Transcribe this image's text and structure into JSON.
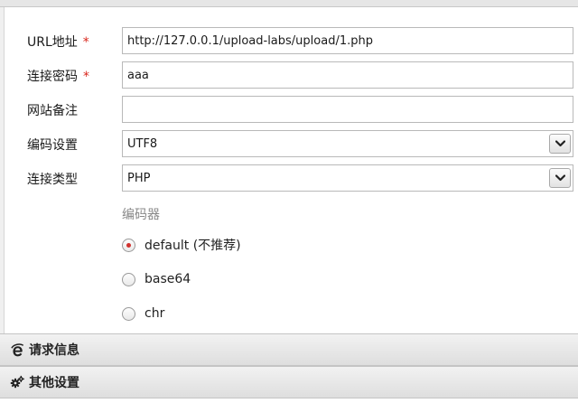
{
  "form": {
    "url": {
      "label": "URL地址",
      "required_mark": "*",
      "value": "http://127.0.0.1/upload-labs/upload/1.php"
    },
    "password": {
      "label": "连接密码",
      "required_mark": "*",
      "value": "aaa"
    },
    "note": {
      "label": "网站备注",
      "value": ""
    },
    "encoding": {
      "label": "编码设置",
      "selected": "UTF8"
    },
    "conn_type": {
      "label": "连接类型",
      "selected": "PHP"
    }
  },
  "encoder": {
    "title": "编码器",
    "options": [
      {
        "label": "default (不推荐)",
        "checked": true
      },
      {
        "label": "base64",
        "checked": false
      },
      {
        "label": "chr",
        "checked": false
      }
    ]
  },
  "sections": {
    "request_info": {
      "label": "请求信息",
      "icon": "ie-logo-icon"
    },
    "other_settings": {
      "label": "其他设置",
      "icon": "gears-icon"
    }
  },
  "colors": {
    "required": "#d9261c",
    "radio_dot": "#d0312d",
    "muted": "#888888"
  }
}
